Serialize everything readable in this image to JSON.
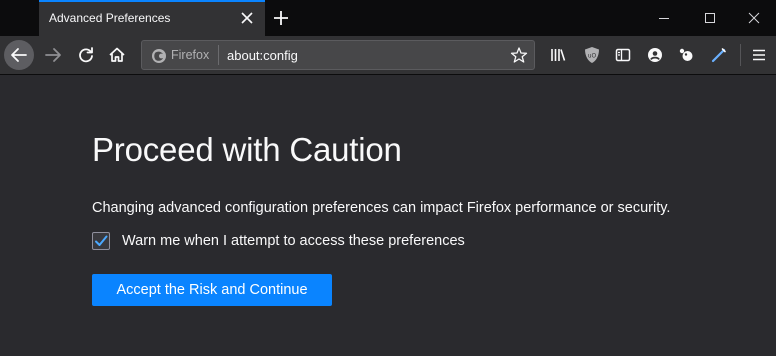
{
  "tab": {
    "title": "Advanced Preferences",
    "close_icon": "close-icon",
    "active_indicator_color": "#0a84ff"
  },
  "new_tab_icon": "plus-icon",
  "window_controls": {
    "minimize_icon": "minimize-icon",
    "maximize_icon": "maximize-icon",
    "close_icon": "close-icon"
  },
  "navigation": {
    "back_icon": "arrow-left-icon",
    "forward_icon": "arrow-right-icon",
    "reload_icon": "reload-icon",
    "home_icon": "home-icon"
  },
  "url_bar": {
    "identity_label": "Firefox",
    "identity_icon": "firefox-icon",
    "value": "about:config",
    "bookmark_icon": "star-icon"
  },
  "toolbar_icons": [
    "library-icon",
    "ublock-icon",
    "sidebar-icon",
    "account-icon",
    "extension-icon",
    "pen-icon",
    "hamburger-menu-icon"
  ],
  "page": {
    "title": "Proceed with Caution",
    "description": "Changing advanced configuration preferences can impact Firefox performance or security.",
    "checkbox_label": "Warn me when I attempt to access these preferences",
    "checkbox_checked": true,
    "button_label": "Accept the Risk and Continue"
  },
  "colors": {
    "content_background": "#2a2a2e",
    "toolbar_background": "#323234",
    "tabstrip_background": "#0c0c0d",
    "accent": "#0a84ff",
    "text": "#f9f9fa"
  }
}
